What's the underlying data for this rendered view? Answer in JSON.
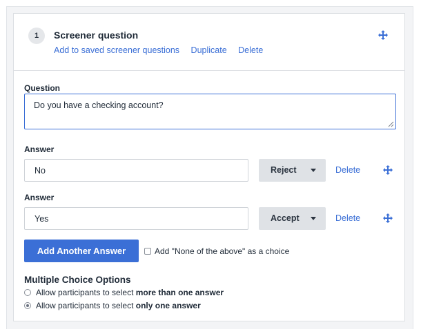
{
  "question_card": {
    "step_number": "1",
    "title": "Screener question",
    "links": {
      "add_saved": "Add to saved screener questions",
      "duplicate": "Duplicate",
      "delete": "Delete"
    }
  },
  "question": {
    "label": "Question",
    "value": "Do you have a checking account?"
  },
  "answers": [
    {
      "label": "Answer",
      "value": "No",
      "action": "Reject",
      "delete_label": "Delete"
    },
    {
      "label": "Answer",
      "value": "Yes",
      "action": "Accept",
      "delete_label": "Delete"
    }
  ],
  "add_answer_button": "Add Another Answer",
  "none_option": {
    "label": "Add \"None of the above\" as a choice",
    "checked": false
  },
  "multiple_choice": {
    "title": "Multiple Choice Options",
    "options": [
      {
        "prefix": "Allow participants to select ",
        "emphasis": "more than one answer",
        "selected": false
      },
      {
        "prefix": "Allow participants to select ",
        "emphasis": "only one answer",
        "selected": true
      }
    ]
  },
  "colors": {
    "accent": "#3b6fd6",
    "dropdown_bg": "#dfe2e6",
    "panel_bg": "#f3f4f6"
  },
  "icons": {
    "move": "move-arrows-icon",
    "caret": "chevron-down-icon",
    "resize": "resize-grip-icon"
  }
}
